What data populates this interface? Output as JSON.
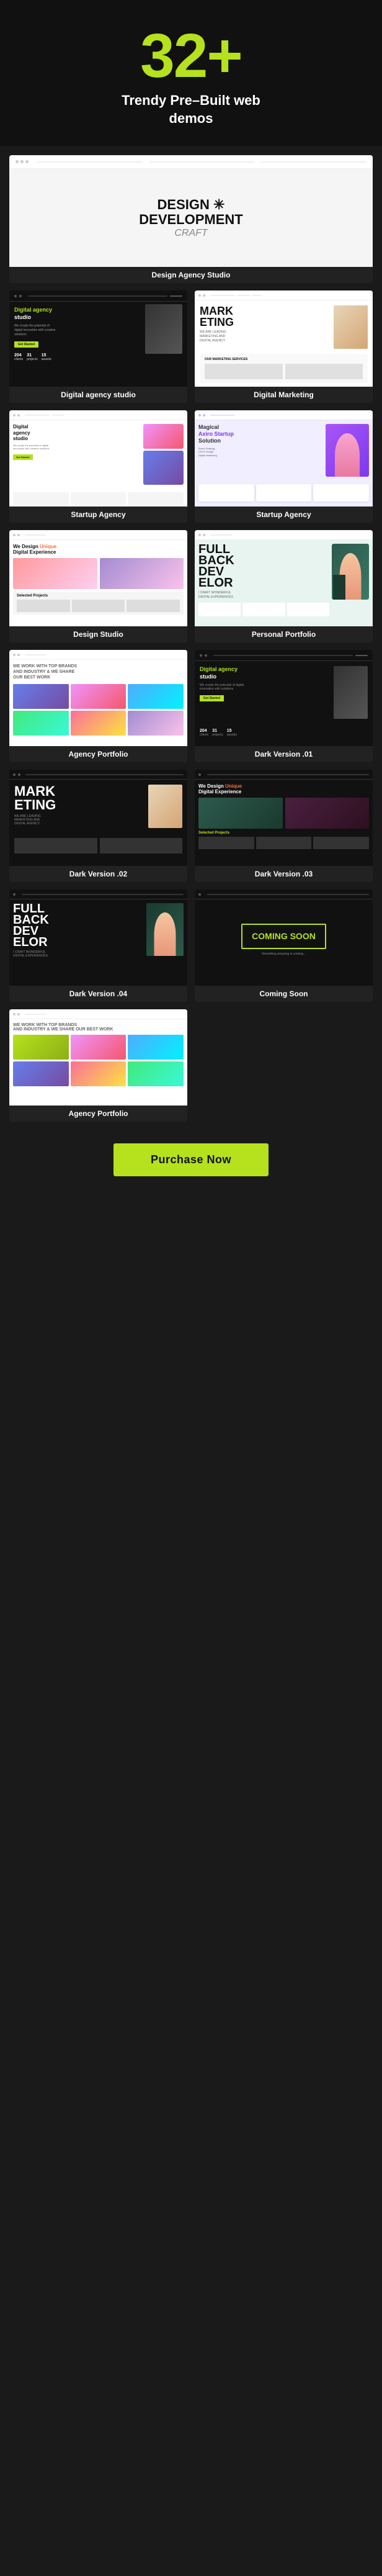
{
  "hero": {
    "number": "32+",
    "subtitle_line1": "Trendy Pre–Built web",
    "subtitle_line2": "demos"
  },
  "demos": [
    {
      "id": "design-agency-studio",
      "label": "Design Agency Studio",
      "full_width": true,
      "type": "das"
    },
    {
      "id": "digital-agency-studio",
      "label": "Digital agency studio",
      "type": "digital"
    },
    {
      "id": "digital-marketing",
      "label": "Digital Marketing",
      "type": "marketing"
    },
    {
      "id": "startup-agency-1",
      "label": "Startup Agency",
      "type": "startup1"
    },
    {
      "id": "startup-agency-2",
      "label": "Startup Agency",
      "type": "startup2"
    },
    {
      "id": "design-studio",
      "label": "Design Studio",
      "type": "design-studio"
    },
    {
      "id": "personal-portfolio",
      "label": "Personal Portfolio",
      "type": "portfolio"
    },
    {
      "id": "agency-portfolio",
      "label": "Agency Portfolio",
      "type": "agency"
    },
    {
      "id": "dark-version-01",
      "label": "Dark Version .01",
      "type": "dark1"
    },
    {
      "id": "dark-version-02",
      "label": "Dark Version .02",
      "type": "dark2"
    },
    {
      "id": "dark-version-03",
      "label": "Dark Version .03",
      "type": "dark3"
    },
    {
      "id": "dark-version-04",
      "label": "Dark Version .04",
      "type": "dark4"
    },
    {
      "id": "coming-soon",
      "label": "Coming Soon",
      "type": "coming"
    },
    {
      "id": "agency-portfolio-2",
      "label": "Agency Portfolio",
      "type": "agency2"
    }
  ],
  "purchase": {
    "button_label": "Purchase Now"
  },
  "mock_text": {
    "das_title_line1": "DESIGN ✳",
    "das_title_line2": "DEVELOPMENT",
    "das_title_line3": "CRAFT",
    "digital_headline": "Digital agency studio",
    "startup1_title": "Startup Agency",
    "startup2_title": "Magical Axiro Startup Solution",
    "marketing_title_1": "MARK",
    "marketing_title_2": "ETING",
    "portfolio_big": "FULL\nBACK\nDEV",
    "dark1_headline": "Digital agency studio",
    "dark2_title1": "MARK",
    "dark2_title2": "ETING",
    "dark3_selected": "Selected Projects Dark Version .03",
    "dark4_big": "FULL\nBACK\nDEV",
    "design_studio_selected": "Selected Projects Design Studio",
    "we_design_unique": "We Design Unique",
    "digital_experience": "Digital Experience",
    "agency_headline": "WE WORK WITH TOP BRANDS AND INDUSTRY & WE SHARE OUR BEST WORK",
    "coming_soon": "COMING SOON"
  }
}
